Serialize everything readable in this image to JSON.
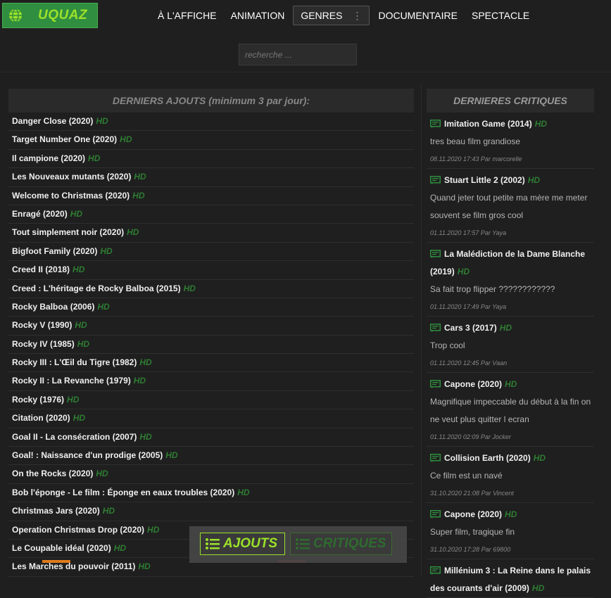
{
  "header": {
    "logo": "UQUAZ",
    "nav": [
      "À L'AFFICHE",
      "ANIMATION",
      "GENRES",
      "DOCUMENTAIRE",
      "SPECTACLE"
    ]
  },
  "search": {
    "placeholder": "recherche ..."
  },
  "ajouts": {
    "title": "DERNIERS AJOUTS (minimum 3 par jour):",
    "hd_label": "HD",
    "items": [
      "Danger Close (2020)",
      "Target Number One (2020)",
      "Il campione (2020)",
      "Les Nouveaux mutants (2020)",
      "Welcome to Christmas (2020)",
      "Enragé (2020)",
      "Tout simplement noir (2020)",
      "Bigfoot Family (2020)",
      "Creed II (2018)",
      "Creed : L'héritage de Rocky Balboa (2015)",
      "Rocky Balboa (2006)",
      "Rocky V (1990)",
      "Rocky IV (1985)",
      "Rocky III : L'Œil du Tigre (1982)",
      "Rocky II : La Revanche (1979)",
      "Rocky (1976)",
      "Citation (2020)",
      "Goal II - La consécration (2007)",
      "Goal! : Naissance d'un prodige (2005)",
      "On the Rocks (2020)",
      "Bob l'éponge - Le film : Éponge en eaux troubles (2020)",
      "Christmas Jars (2020)",
      "Operation Christmas Drop (2020)",
      "Le Coupable idéal (2020)",
      "Les Marches du pouvoir (2011)"
    ]
  },
  "critiques": {
    "title": "DERNIERES CRITIQUES",
    "items": [
      {
        "title": "Imitation Game (2014)",
        "text": "tres beau film grandiose",
        "meta": "08.11.2020 17:43 Par marcorelle"
      },
      {
        "title": "Stuart Little 2 (2002)",
        "text": "Quand jeter tout petite ma mère me meter souvent se film gros cool",
        "meta": "01.11.2020 17:57 Par Yaya"
      },
      {
        "title": "La Malédiction de la Dame Blanche (2019)",
        "text": "Sa fait trop flipper ????????????",
        "meta": "01.11.2020 17:49 Par Yaya"
      },
      {
        "title": "Cars 3 (2017)",
        "text": "Trop cool",
        "meta": "01.11.2020 12:45 Par Vaan"
      },
      {
        "title": "Capone (2020)",
        "text": "Magnifique impeccable du début à la fin on ne veut plus quitter l ecran",
        "meta": "01.11.2020 02:09 Par Jocker"
      },
      {
        "title": "Collision Earth (2020)",
        "text": "Ce film est un navé",
        "meta": "31.10.2020 21:08 Par Vincent"
      },
      {
        "title": "Capone (2020)",
        "text": "Super film, tragique fin",
        "meta": "31.10.2020 17:28 Par 69800"
      },
      {
        "title": "Millénium 3 : La Reine dans le palais des courants d'air (2009)",
        "text": "",
        "meta": ""
      }
    ]
  },
  "bottom_tabs": {
    "ajouts": "AJOUTS",
    "critiques": "CRITIQUES"
  },
  "colors": {
    "accent": "#9be12a",
    "hd": "#2e7d32",
    "bg": "#1f1f1f",
    "logo_bg": "#2f8e3f"
  }
}
